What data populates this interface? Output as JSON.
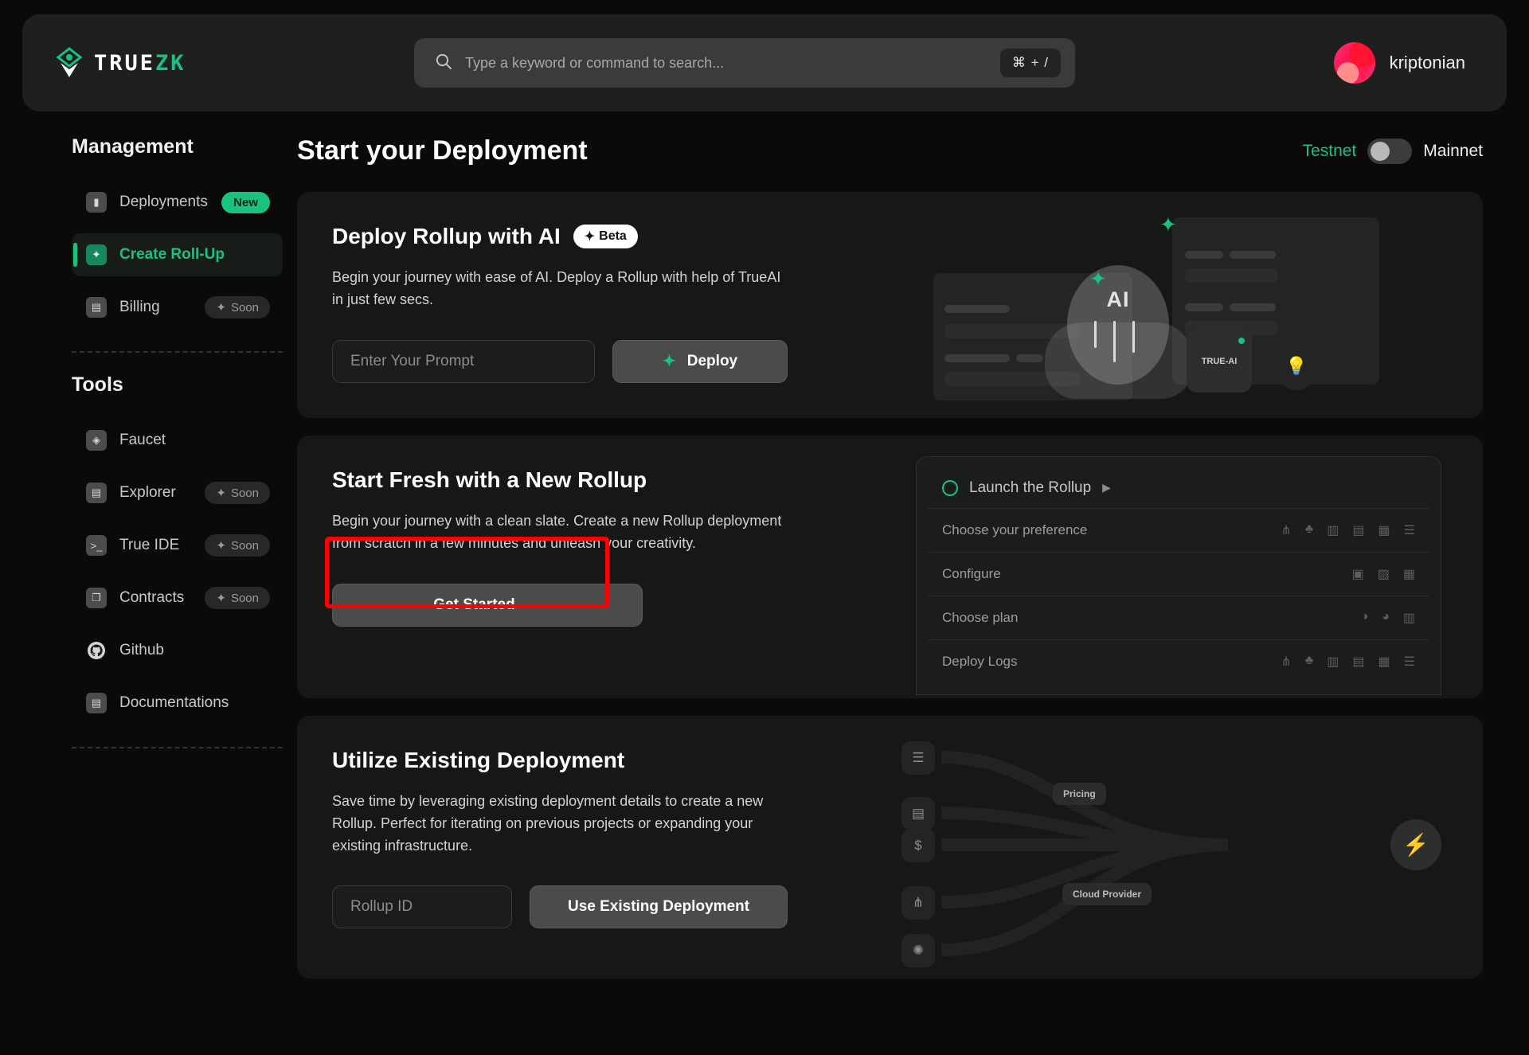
{
  "header": {
    "brand_primary": "TRUE",
    "brand_accent": "ZK",
    "search_placeholder": "Type a keyword or command to search...",
    "search_value": "",
    "shortcut": "⌘ + /",
    "username": "kriptonian"
  },
  "sidebar": {
    "sections": [
      {
        "title": "Management",
        "items": [
          {
            "label": "Deployments",
            "badge": "New",
            "badge_type": "new",
            "icon": "deployments-icon",
            "active": false
          },
          {
            "label": "Create Roll-Up",
            "badge": "",
            "badge_type": "none",
            "icon": "create-rollup-icon",
            "active": true
          },
          {
            "label": "Billing",
            "badge": "Soon",
            "badge_type": "soon",
            "icon": "billing-icon",
            "active": false
          }
        ]
      },
      {
        "title": "Tools",
        "items": [
          {
            "label": "Faucet",
            "badge": "",
            "badge_type": "none",
            "icon": "faucet-icon",
            "active": false
          },
          {
            "label": "Explorer",
            "badge": "Soon",
            "badge_type": "soon",
            "icon": "explorer-icon",
            "active": false
          },
          {
            "label": "True IDE",
            "badge": "Soon",
            "badge_type": "soon",
            "icon": "terminal-icon",
            "active": false
          },
          {
            "label": "Contracts",
            "badge": "Soon",
            "badge_type": "soon",
            "icon": "contracts-icon",
            "active": false
          },
          {
            "label": "Github",
            "badge": "",
            "badge_type": "none",
            "icon": "github-icon",
            "active": false
          },
          {
            "label": "Documentations",
            "badge": "",
            "badge_type": "none",
            "icon": "document-icon",
            "active": false
          }
        ]
      }
    ]
  },
  "main": {
    "page_title": "Start your Deployment",
    "network_toggle": {
      "left_label": "Testnet",
      "right_label": "Mainnet",
      "selected": "Testnet"
    },
    "cards": [
      {
        "title": "Deploy Rollup with AI",
        "badge": "Beta",
        "description": "Begin your journey with ease of AI. Deploy a Rollup with help of TrueAI in just few secs.",
        "input_placeholder": "Enter Your Prompt",
        "input_value": "",
        "button_label": "Deploy"
      },
      {
        "title": "Start Fresh with a New Rollup",
        "description": "Begin your journey with a clean slate. Create a new Rollup deployment from scratch in a few minutes and unleash your creativity.",
        "button_label": "Get Started"
      },
      {
        "title": "Utilize Existing Deployment",
        "description": "Save time by leveraging existing deployment details to create a new Rollup. Perfect for iterating on previous projects or expanding your existing infrastructure.",
        "input_placeholder": "Rollup ID",
        "input_value": "",
        "button_label": "Use Existing Deployment"
      }
    ]
  },
  "ai_illustration": {
    "badge_label": "AI",
    "chip_label": "TRUE-AI"
  },
  "wizard_illustration": {
    "header": "Launch the Rollup",
    "rows": [
      {
        "label": "Choose your preference"
      },
      {
        "label": "Configure"
      },
      {
        "label": "Choose plan"
      },
      {
        "label": "Deploy Logs"
      }
    ]
  },
  "flow_illustration": {
    "pills": [
      "Pricing",
      "Cloud Provider"
    ]
  },
  "colors": {
    "accent_green": "#19c27e",
    "background": "#0a0a0a",
    "card": "#161717",
    "highlight_red": "#ff0000"
  }
}
